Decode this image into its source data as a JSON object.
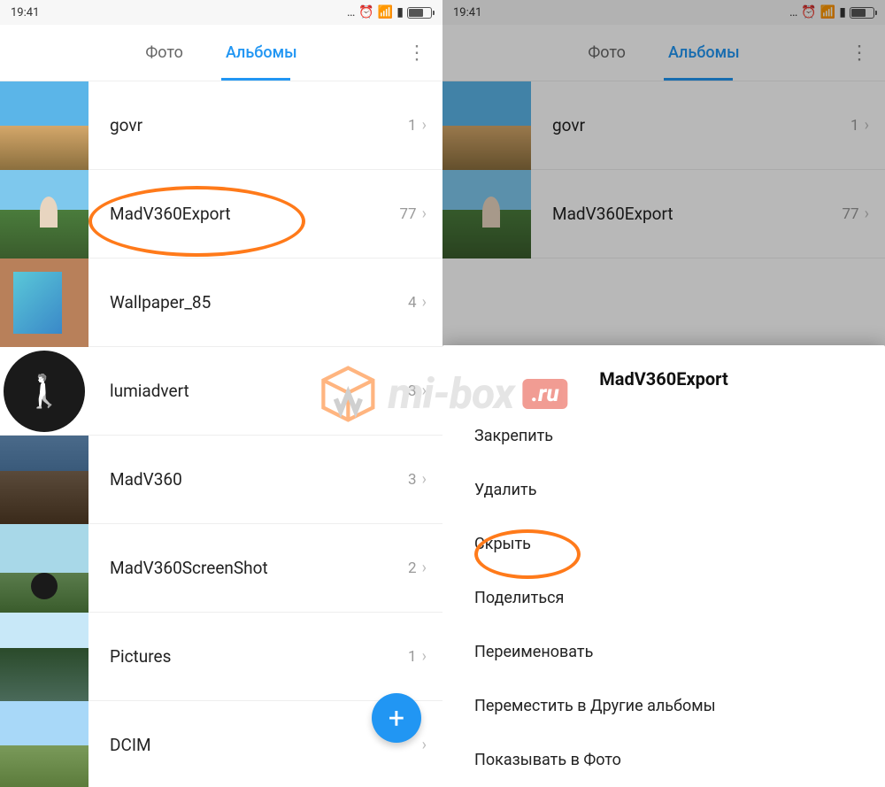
{
  "status": {
    "time": "19:41"
  },
  "tabs": {
    "photo": "Фото",
    "albums": "Альбомы"
  },
  "albums": [
    {
      "name": "govr",
      "count": "1",
      "thumb": "th-govr"
    },
    {
      "name": "MadV360Export",
      "count": "77",
      "thumb": "th-madv"
    },
    {
      "name": "Wallpaper_85",
      "count": "4",
      "thumb": "th-wall"
    },
    {
      "name": "lumiadvert",
      "count": "3",
      "thumb": "th-lumi"
    },
    {
      "name": "MadV360",
      "count": "3",
      "thumb": "th-mv360"
    },
    {
      "name": "MadV360ScreenShot",
      "count": "2",
      "thumb": "th-shot"
    },
    {
      "name": "Pictures",
      "count": "1",
      "thumb": "th-pic"
    },
    {
      "name": "DCIM",
      "count": "",
      "thumb": "th-dcim"
    }
  ],
  "albums_right": [
    {
      "name": "govr",
      "count": "1",
      "thumb": "th-govr"
    },
    {
      "name": "MadV360Export",
      "count": "77",
      "thumb": "th-madv"
    }
  ],
  "context_menu": {
    "title": "MadV360Export",
    "items": [
      "Закрепить",
      "Удалить",
      "Скрыть",
      "Поделиться",
      "Переименовать",
      "Переместить в Другие альбомы",
      "Показывать в Фото"
    ]
  },
  "watermark": {
    "text": "mi-box",
    "suffix": ".ru"
  }
}
